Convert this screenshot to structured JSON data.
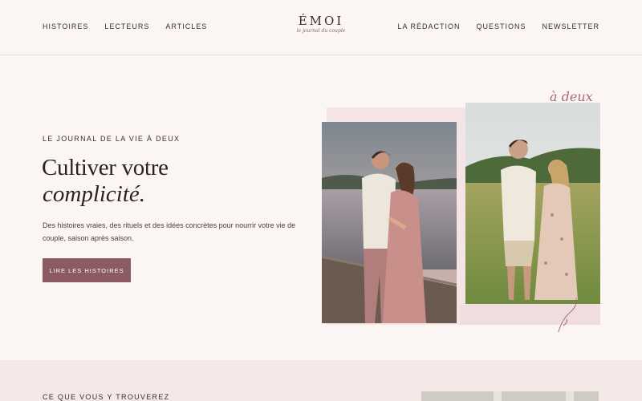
{
  "brand": {
    "name": "ÉMOI",
    "tagline": "le journal du couple"
  },
  "nav_left": [
    "Histoires",
    "Lecteurs",
    "Articles"
  ],
  "nav_right": [
    "La Rédaction",
    "Questions",
    "Newsletter"
  ],
  "hero": {
    "eyebrow": "Le journal de la vie à deux",
    "title_line1": "Cultiver votre",
    "title_line2": "complicité.",
    "lead": "Des histoires vraies, des rituels et des idées concrètes pour nourrir votre vie de couple, saison après saison.",
    "cta_label": "Lire les histoires",
    "script_label": "à deux",
    "accent_color": "#8b5a62"
  },
  "section": {
    "eyebrow": "Ce que vous y trouverez"
  }
}
